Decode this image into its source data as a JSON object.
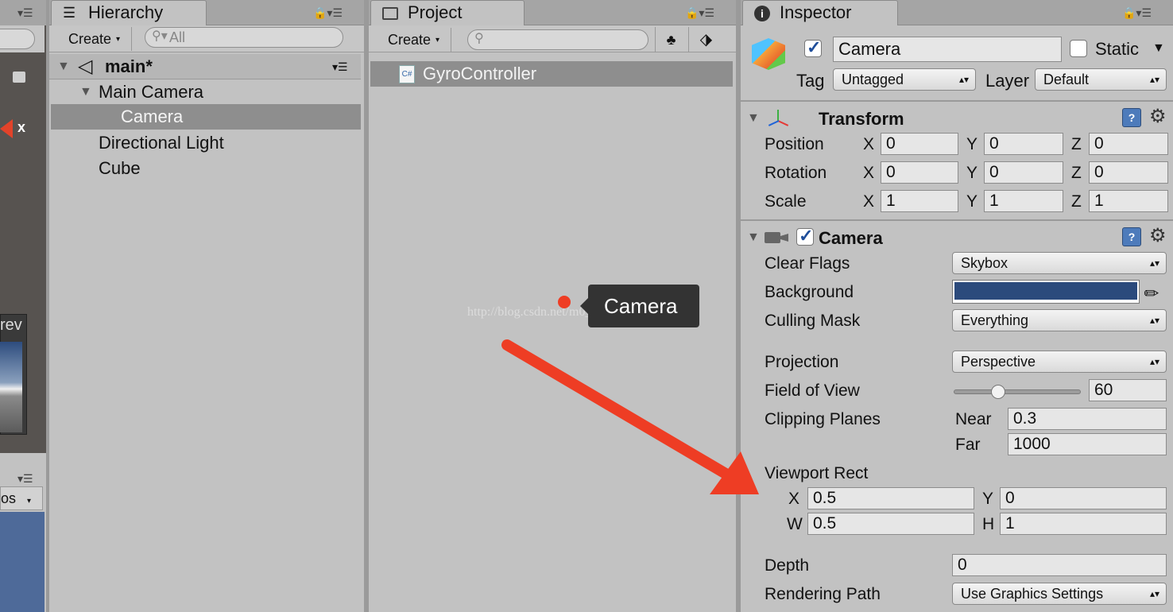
{
  "hierarchy": {
    "tab": "Hierarchy",
    "create": "Create",
    "search_placeholder": "All",
    "scene": "main*",
    "items": [
      "Main Camera",
      "Camera",
      "Directional Light",
      "Cube"
    ]
  },
  "project": {
    "tab": "Project",
    "create": "Create",
    "file": "GyroController",
    "file_icon": "C#"
  },
  "tooltip": {
    "text": "Camera",
    "watermark": "http://blog.csdn.net/m0_37998140"
  },
  "left_fragment": {
    "text1": "rev",
    "text2": "os"
  },
  "inspector": {
    "tab": "Inspector",
    "object_name": "Camera",
    "static_label": "Static",
    "static_checked": false,
    "active_checked": true,
    "tag_label": "Tag",
    "tag_value": "Untagged",
    "layer_label": "Layer",
    "layer_value": "Default",
    "transform": {
      "title": "Transform",
      "position_label": "Position",
      "rotation_label": "Rotation",
      "scale_label": "Scale",
      "axis_x": "X",
      "axis_y": "Y",
      "axis_z": "Z",
      "position": [
        "0",
        "0",
        "0"
      ],
      "rotation": [
        "0",
        "0",
        "0"
      ],
      "scale": [
        "1",
        "1",
        "1"
      ]
    },
    "camera": {
      "title": "Camera",
      "enabled": true,
      "clear_flags_label": "Clear Flags",
      "clear_flags": "Skybox",
      "background_label": "Background",
      "background_color": "#2b4a7c",
      "culling_mask_label": "Culling Mask",
      "culling_mask": "Everything",
      "projection_label": "Projection",
      "projection": "Perspective",
      "fov_label": "Field of View",
      "fov": "60",
      "fov_slider_fraction": 0.35,
      "clipping_label": "Clipping Planes",
      "near_label": "Near",
      "near": "0.3",
      "far_label": "Far",
      "far": "1000",
      "viewport_label": "Viewport Rect",
      "vp_x_label": "X",
      "vp_x": "0.5",
      "vp_y_label": "Y",
      "vp_y": "0",
      "vp_w_label": "W",
      "vp_w": "0.5",
      "vp_h_label": "H",
      "vp_h": "1",
      "depth_label": "Depth",
      "depth": "0",
      "rendering_path_label": "Rendering Path",
      "rendering_path": "Use Graphics Settings"
    }
  },
  "colors": {
    "arrow": "#ee3d24",
    "selection": "#8e8e8e",
    "panel": "#c2c2c2"
  }
}
